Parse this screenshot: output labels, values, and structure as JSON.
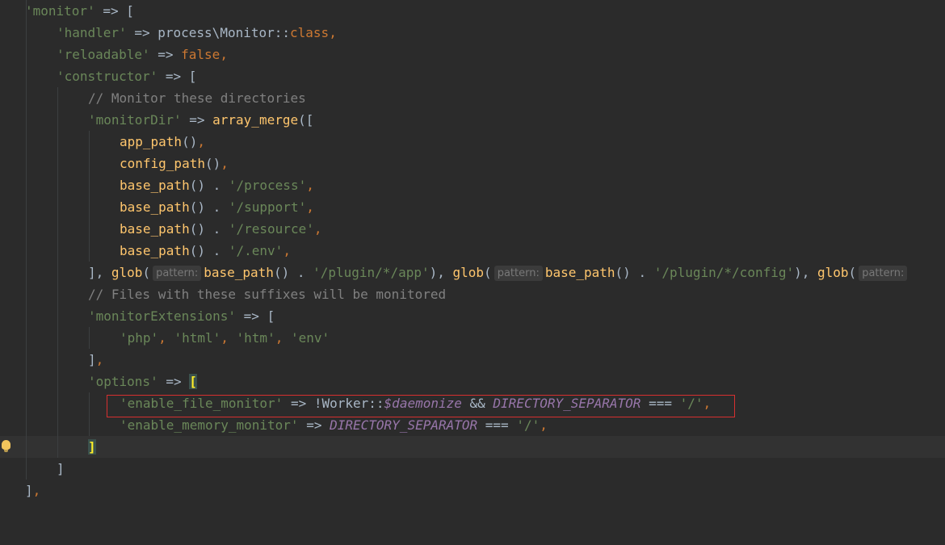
{
  "code": {
    "l1_key": "'monitor'",
    "arrow": "=>",
    "open_bracket": "[",
    "handler_key": "'handler'",
    "handler_ns": "process\\Monitor::",
    "class_kw": "class",
    "comma": ",",
    "reloadable_key": "'reloadable'",
    "false_kw": "false",
    "constructor_key": "'constructor'",
    "comment_dirs": "// Monitor these directories",
    "monitorDir_key": "'monitorDir'",
    "array_merge_fn": "array_merge",
    "paren_bracket_open": "([",
    "app_path_fn": "app_path",
    "config_path_fn": "config_path",
    "base_path_fn": "base_path",
    "parens": "()",
    "concat": " . ",
    "str_process": "'/process'",
    "str_support": "'/support'",
    "str_resource": "'/resource'",
    "str_env": "'/.env'",
    "close_bracket_comma": "], ",
    "glob_fn": "glob",
    "paren_open": "(",
    "paren_close_comma": "), ",
    "pattern_hint": "pattern:",
    "str_plugin_app": "'/plugin/*/app'",
    "str_plugin_config": "'/plugin/*/config'",
    "comment_ext": "// Files with these suffixes will be monitored",
    "monitorExtensions_key": "'monitorExtensions'",
    "ext_php": "'php'",
    "ext_html": "'html'",
    "ext_htm": "'htm'",
    "ext_env": "'env'",
    "close_bracket": "]",
    "close_bracket_trailing": "],",
    "options_key": "'options'",
    "enable_file_monitor_key": "'enable_file_monitor'",
    "not_worker": "!Worker::",
    "daemonize_var": "$daemonize",
    "and_op": " && ",
    "dir_sep_const": "DIRECTORY_SEPARATOR",
    "strict_eq": " === ",
    "str_slash": "'/'",
    "enable_memory_monitor_key": "'enable_memory_monitor'"
  },
  "colors": {
    "background": "#2b2b2b",
    "string": "#6a8759",
    "keyword": "#cc7832",
    "function": "#ffc66d",
    "comment": "#808080",
    "constant": "#9876aa",
    "highlight_box": "#d63030"
  },
  "icons": {
    "gutter": "intention-bulb-icon"
  }
}
